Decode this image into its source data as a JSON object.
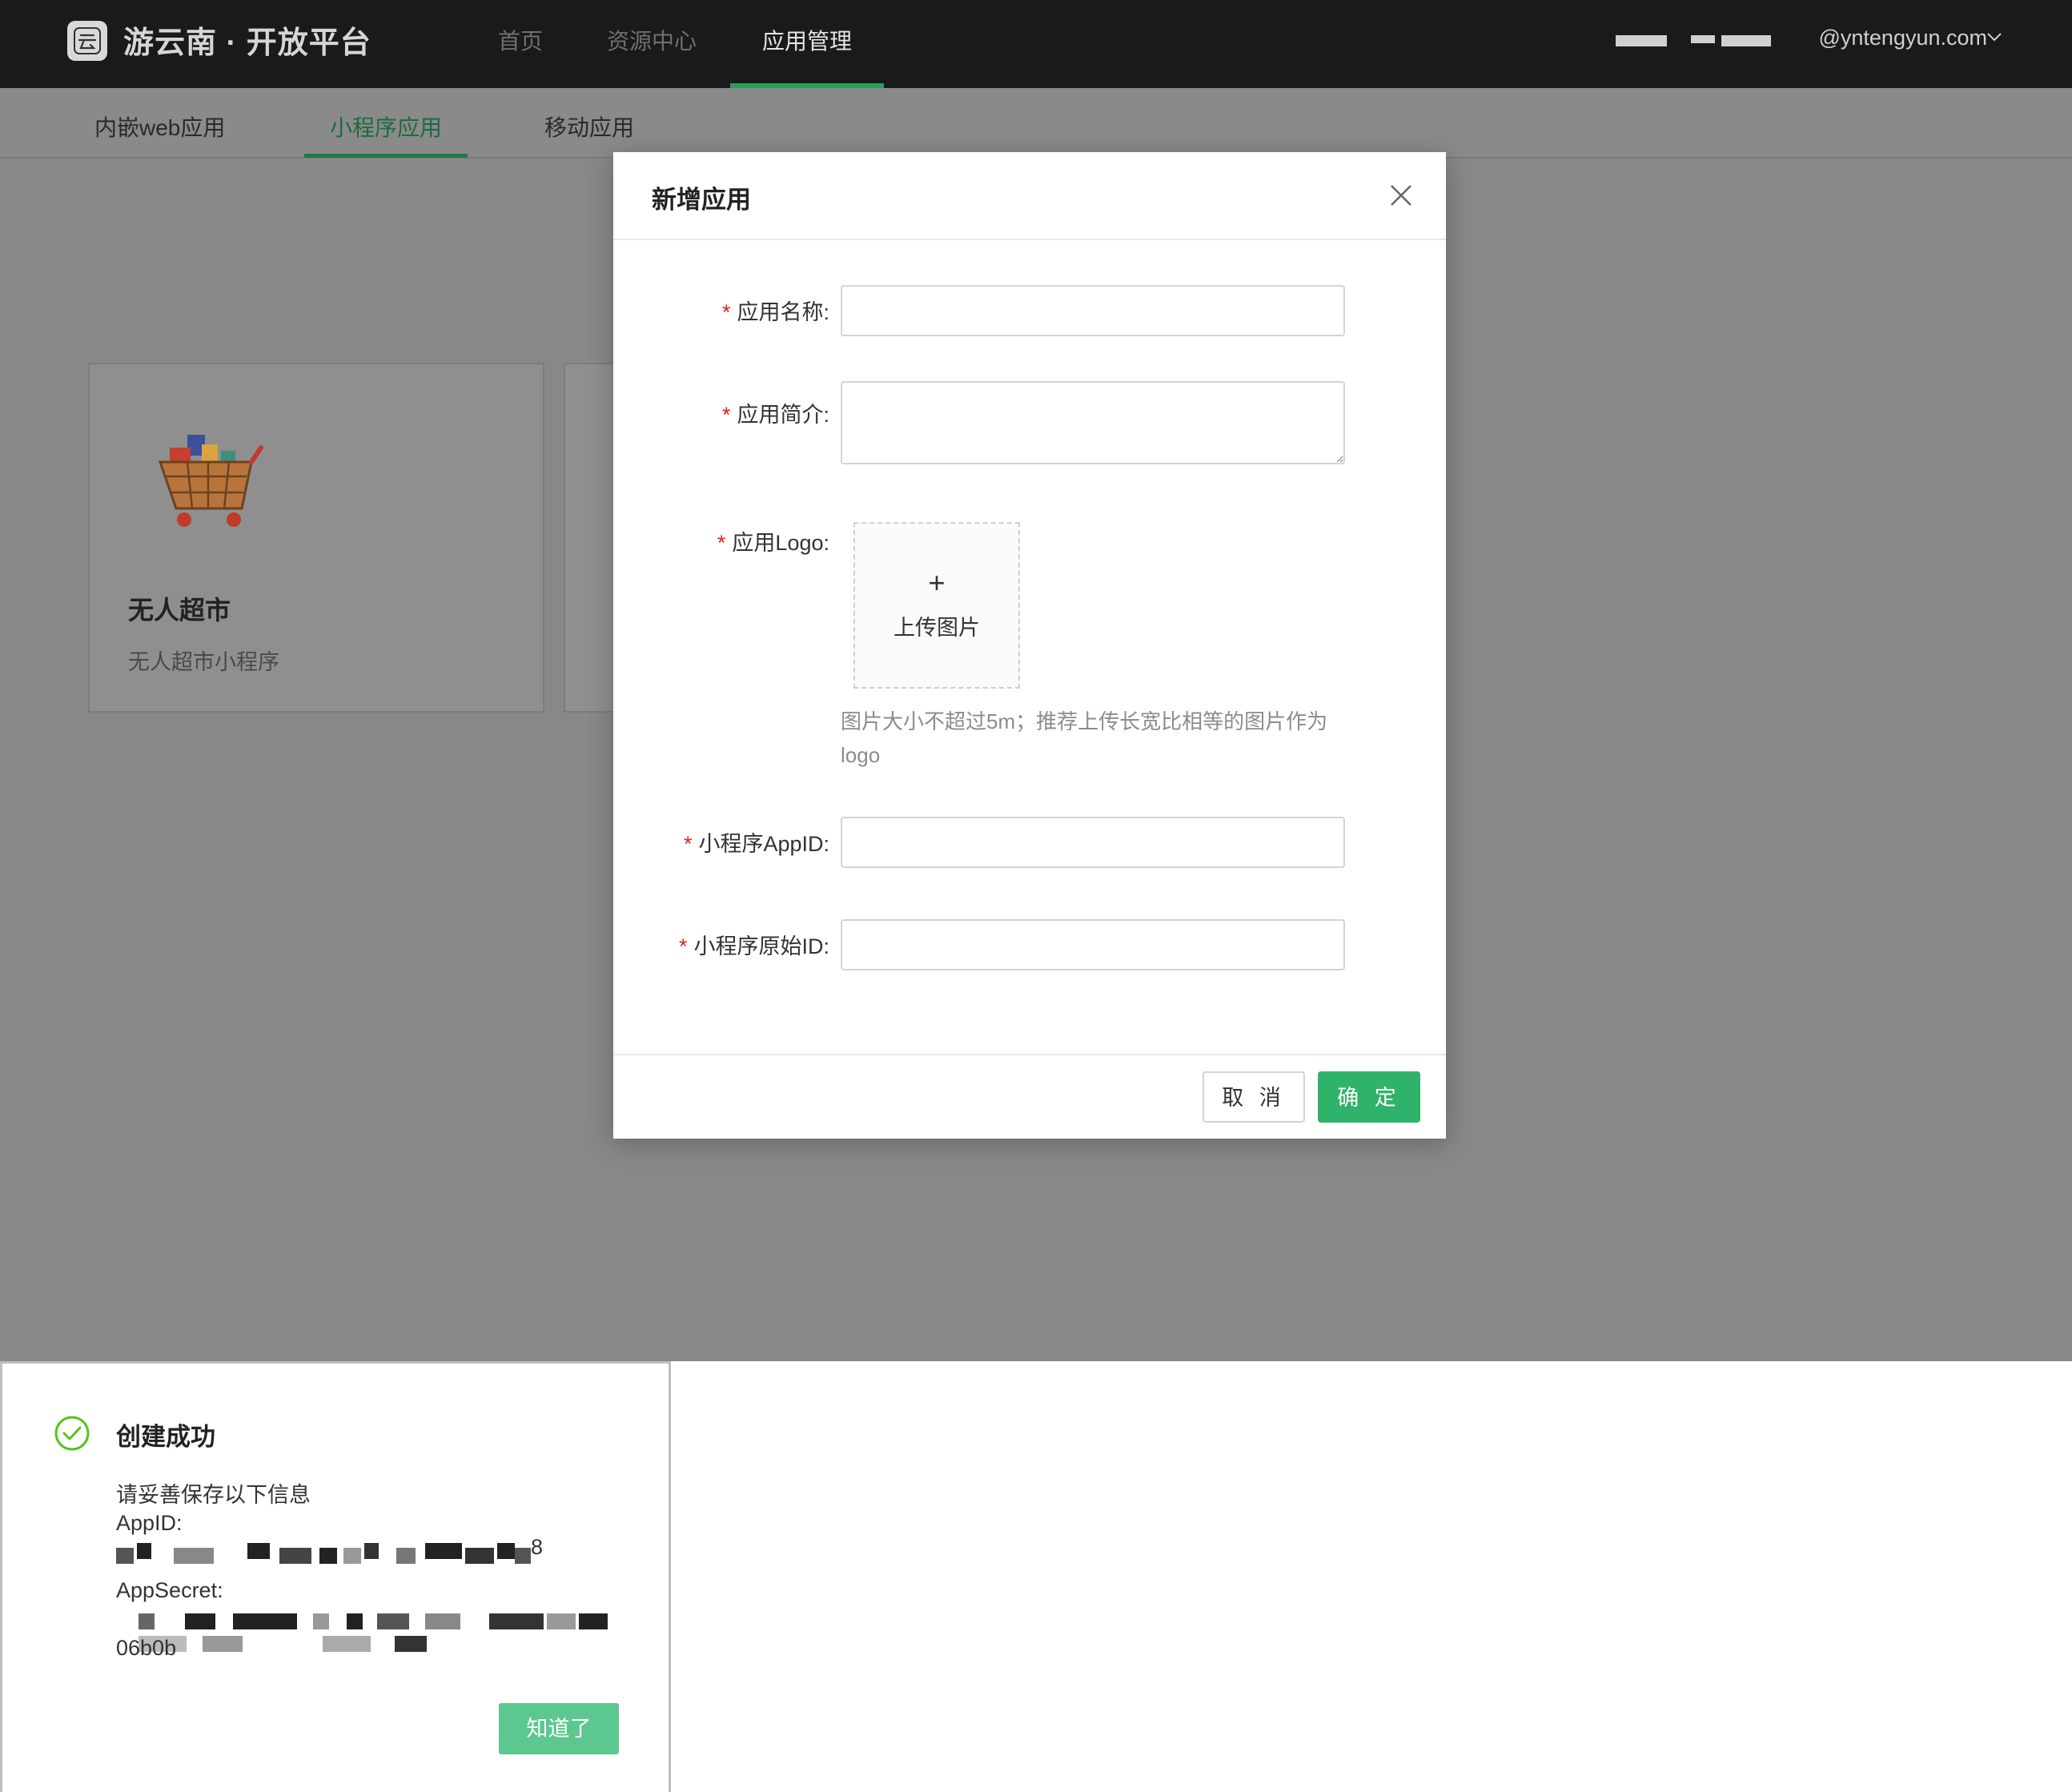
{
  "header": {
    "brand": "游云南 · 开放平台",
    "nav": [
      "首页",
      "资源中心",
      "应用管理"
    ],
    "user_suffix": "@yntengyun.com"
  },
  "subtabs": [
    "内嵌web应用",
    "小程序应用",
    "移动应用"
  ],
  "card": {
    "title": "无人超市",
    "subtitle": "无人超市小程序"
  },
  "modal": {
    "title": "新增应用",
    "fields": {
      "name_label": "应用名称:",
      "intro_label": "应用简介:",
      "logo_label": "应用Logo:",
      "appid_label": "小程序AppID:",
      "raw_id_label": "小程序原始ID:"
    },
    "upload_plus": "+",
    "upload_text": "上传图片",
    "hint": "图片大小不超过5m；推荐上传长宽比相等的图片作为logo",
    "cancel": "取 消",
    "confirm": "确 定"
  },
  "notice": {
    "title": "创建成功",
    "line1": "请妥善保存以下信息",
    "appid_label": "AppID:",
    "appid_tail": "8",
    "secret_label": "AppSecret:",
    "secret_tail": "06b0b",
    "button": "知道了"
  },
  "colors": {
    "accent": "#2fb36a",
    "success": "#52c41a",
    "required": "#e02020"
  }
}
